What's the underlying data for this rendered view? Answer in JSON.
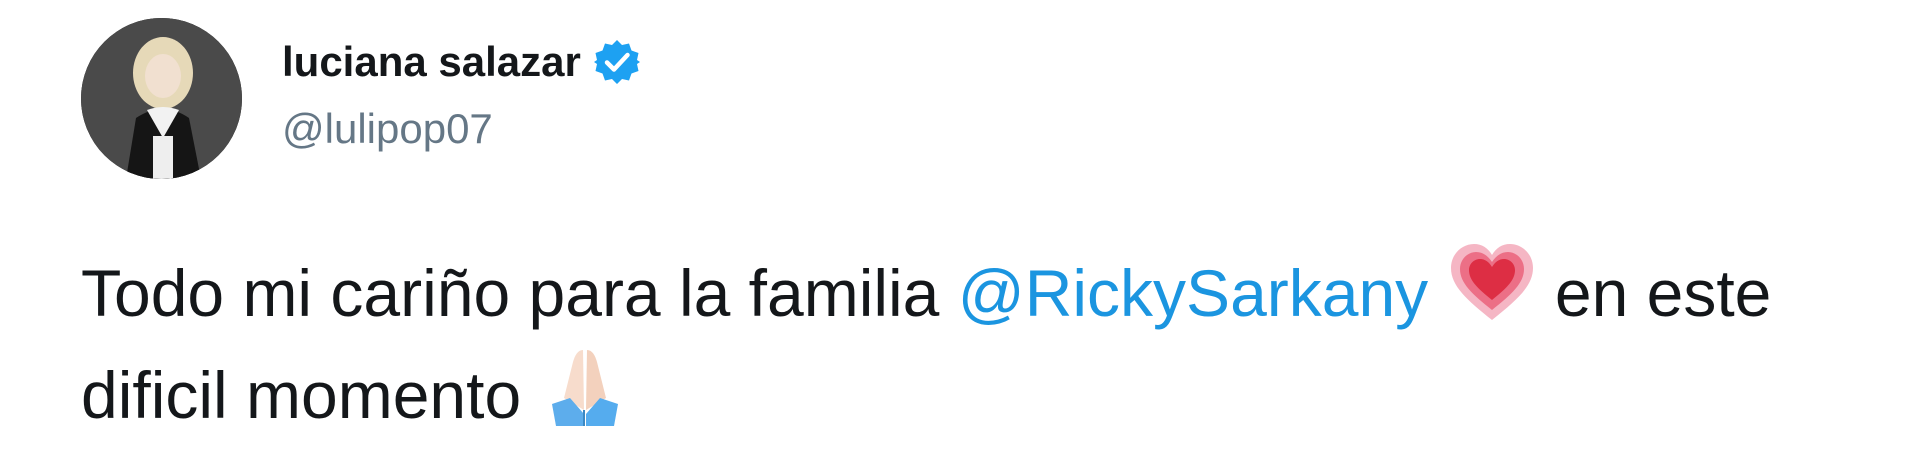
{
  "user": {
    "display_name": "luciana salazar",
    "handle": "@lulipop07",
    "verified_icon": "verified-badge-icon",
    "verified_color": "#1da1f2"
  },
  "tweet": {
    "text_before": "Todo mi cariño para la familia ",
    "mention": "@RickySarkany",
    "heart_emoji": "heart-emoji-icon",
    "text_middle": " en este dificil momento ",
    "pray_emoji": "folded-hands-emoji-icon",
    "mention_color": "#1b95e0",
    "text_color": "#14171a"
  }
}
